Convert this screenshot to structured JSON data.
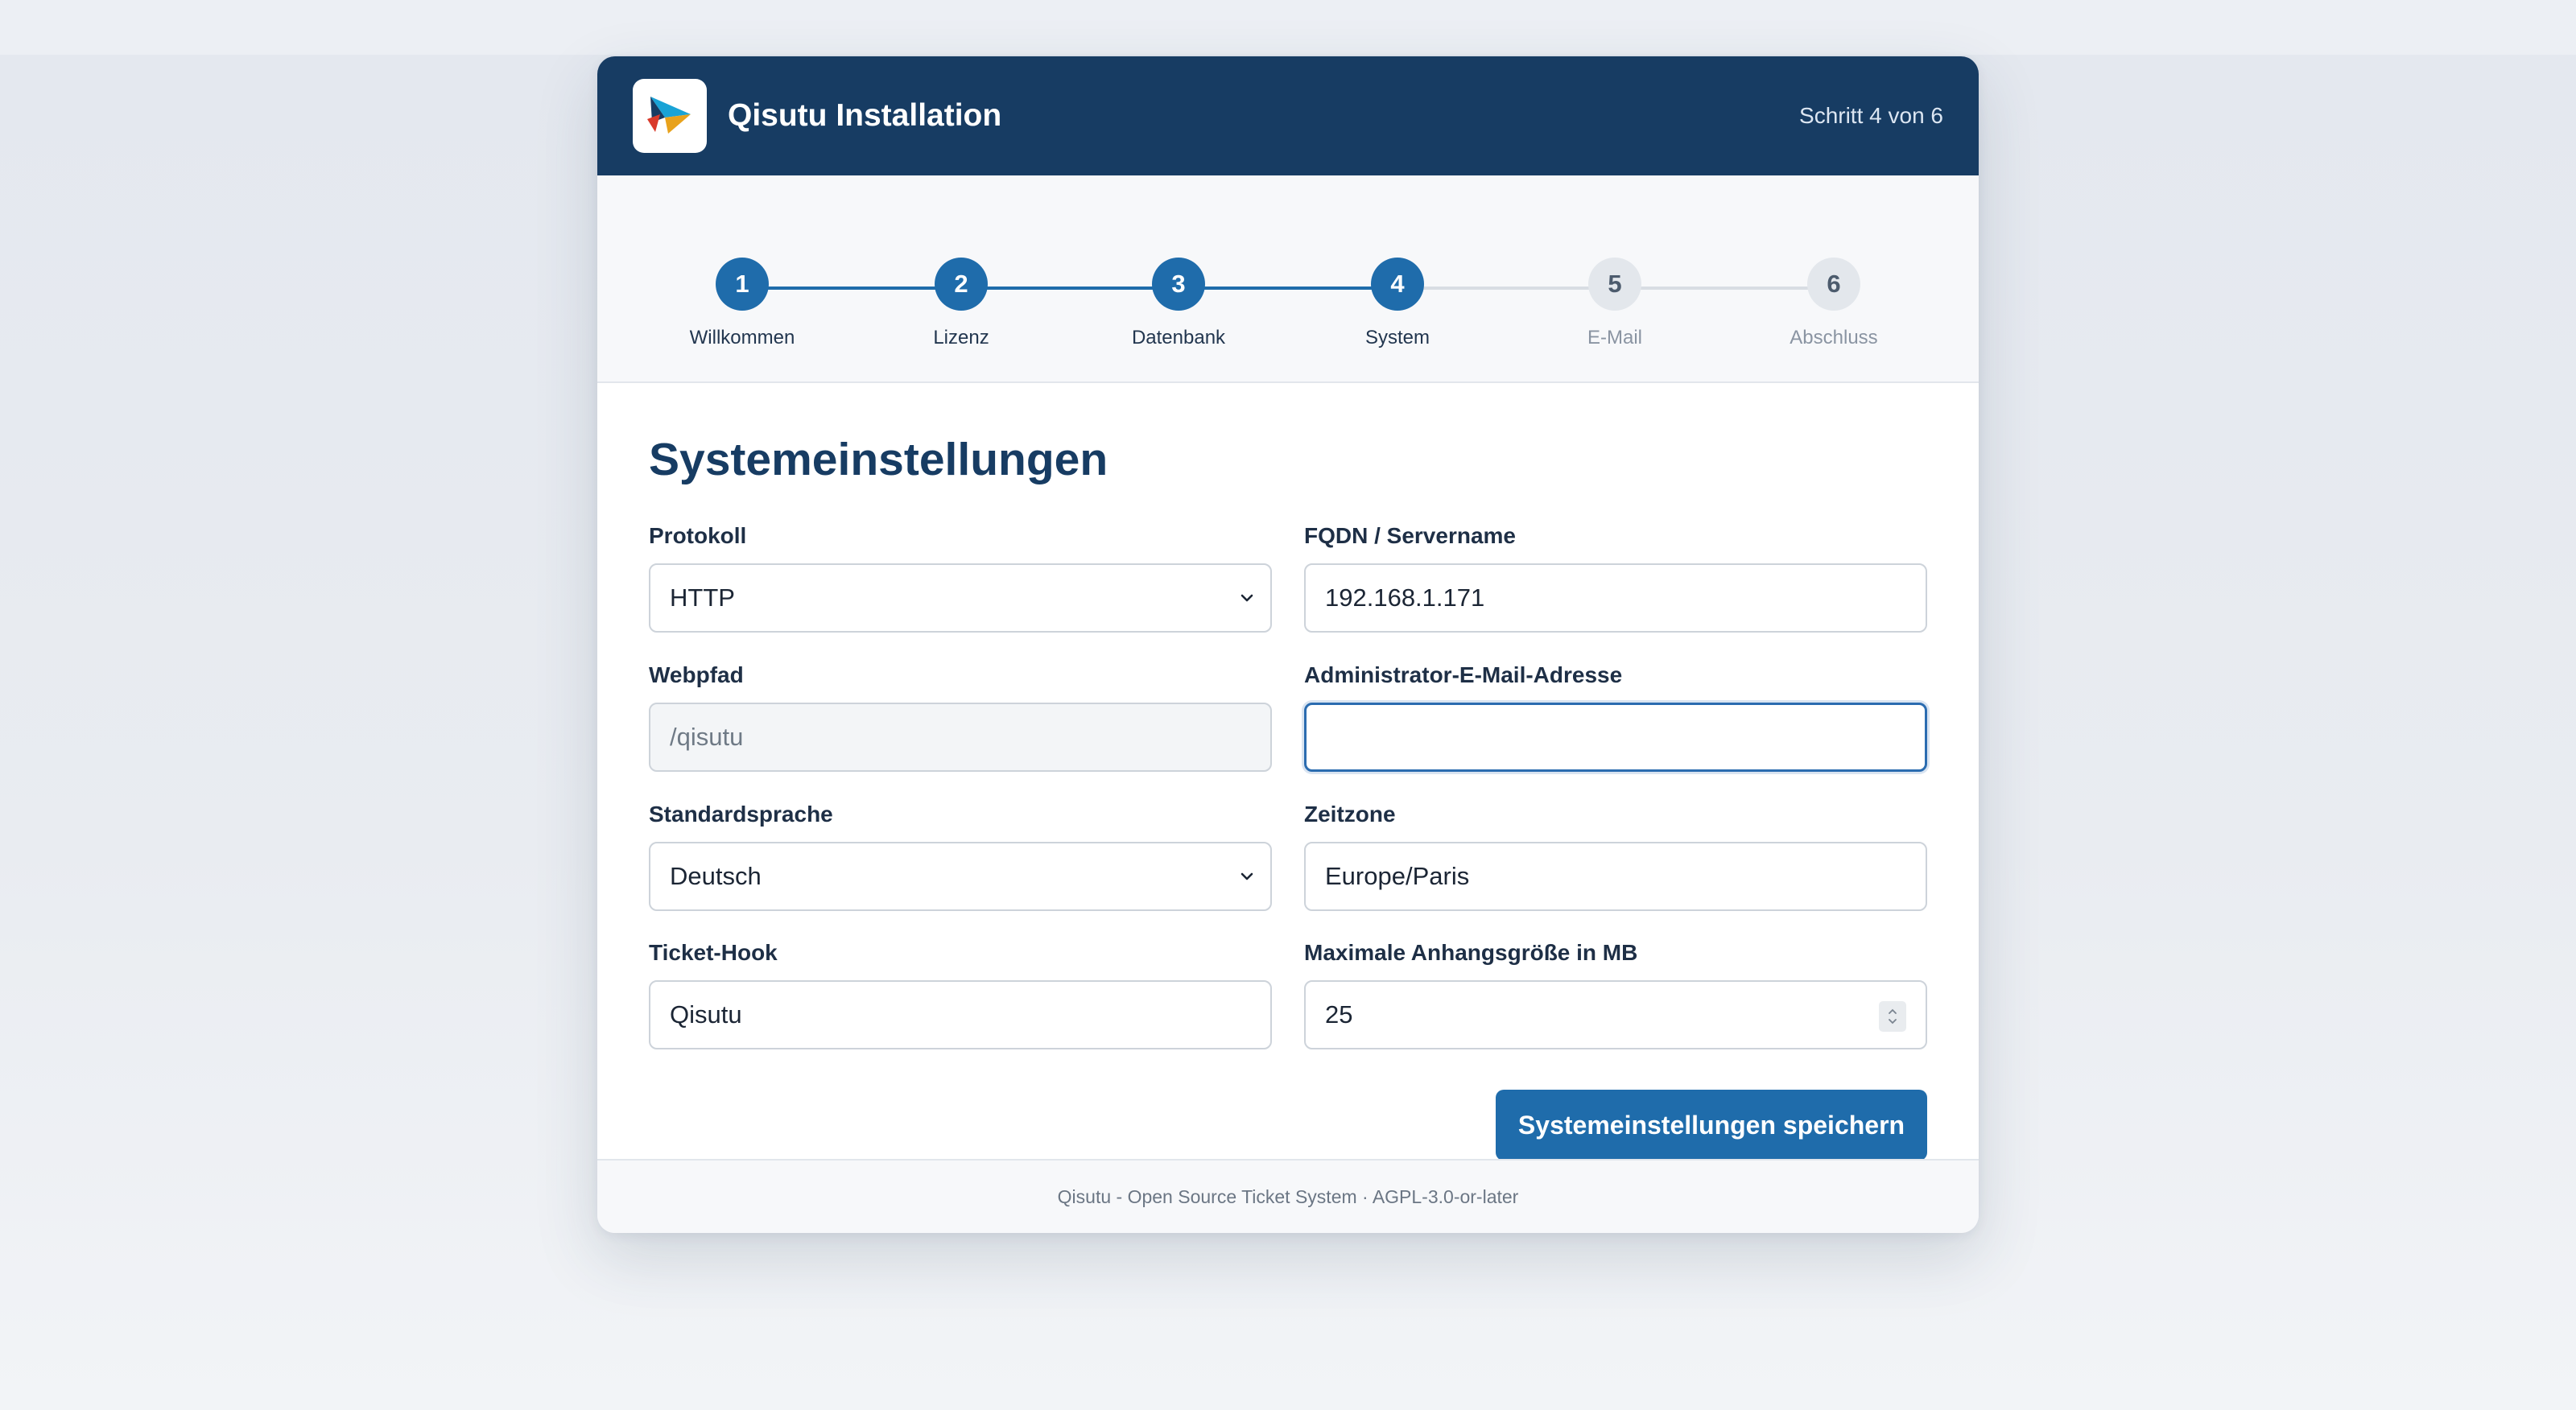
{
  "header": {
    "title": "Qisutu Installation",
    "step_indicator": "Schritt 4 von 6",
    "logo_icon": "qisutu-logo-icon"
  },
  "stepper": {
    "steps": [
      {
        "number": "1",
        "label": "Willkommen",
        "state": "done"
      },
      {
        "number": "2",
        "label": "Lizenz",
        "state": "done"
      },
      {
        "number": "3",
        "label": "Datenbank",
        "state": "done"
      },
      {
        "number": "4",
        "label": "System",
        "state": "current"
      },
      {
        "number": "5",
        "label": "E-Mail",
        "state": "pending"
      },
      {
        "number": "6",
        "label": "Abschluss",
        "state": "pending"
      }
    ],
    "colors": {
      "done": "#1f6cab",
      "pending": "#e3e7ec"
    }
  },
  "form": {
    "title": "Systemeinstellungen",
    "protocol": {
      "label": "Protokoll",
      "value": "HTTP"
    },
    "fqdn": {
      "label": "FQDN / Servername",
      "value": "192.168.1.171"
    },
    "webpath": {
      "label": "Webpfad",
      "value": "/qisutu",
      "disabled": true
    },
    "admin_email": {
      "label": "Administrator-E-Mail-Adresse",
      "value": "",
      "focused": true
    },
    "language": {
      "label": "Standardsprache",
      "value": "Deutsch"
    },
    "timezone": {
      "label": "Zeitzone",
      "value": "Europe/Paris"
    },
    "ticket_hook": {
      "label": "Ticket-Hook",
      "value": "Qisutu"
    },
    "max_attachment": {
      "label": "Maximale Anhangsgröße in MB",
      "value": "25"
    },
    "save_label": "Systemeinstellungen speichern"
  },
  "footer": {
    "text": "Qisutu - Open Source Ticket System · AGPL-3.0-or-later"
  },
  "colors": {
    "header_bg": "#173c63",
    "accent": "#1f6cab",
    "page_bg": "#eceff4"
  }
}
